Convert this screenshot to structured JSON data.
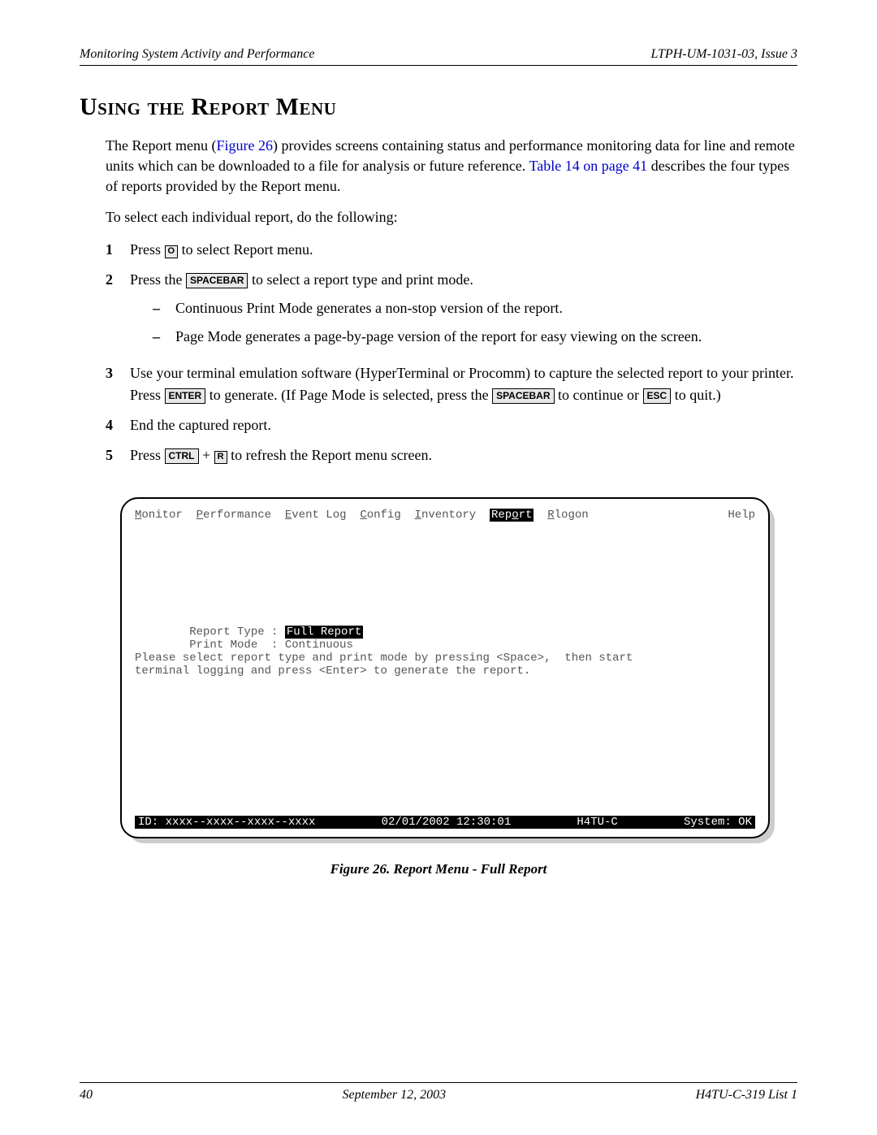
{
  "header": {
    "left": "Monitoring System Activity and Performance",
    "right": "LTPH-UM-1031-03, Issue 3"
  },
  "section_title": "Using the Report Menu",
  "intro": {
    "p1a": "The Report menu (",
    "fig_link": "Figure 26",
    "p1b": ") provides screens containing status and performance monitoring data for line and remote units which can be downloaded to a file for analysis or future reference. ",
    "table_link": "Table 14 on page 41",
    "p1c": " describes the four types of reports provided by the Report menu.",
    "p2": "To select each individual report, do the following:"
  },
  "steps": {
    "s1": {
      "num": "1",
      "a": "Press ",
      "key": "O",
      "b": " to select Report menu."
    },
    "s2": {
      "num": "2",
      "a": "Press the ",
      "key": "SPACEBAR",
      "b": " to select a report type and print mode.",
      "sub1": "Continuous Print Mode generates a non-stop version of the report.",
      "sub2": "Page Mode generates a page-by-page version of the report for easy viewing on the screen."
    },
    "s3": {
      "num": "3",
      "a": "Use your terminal emulation software (HyperTerminal or Procomm) to capture the selected report to your printer. Press ",
      "key1": "ENTER",
      "b": " to generate. (If Page Mode is selected, press the ",
      "key2": "SPACEBAR",
      "c": " to continue or ",
      "key3": "ESC",
      "d": " to quit.)"
    },
    "s4": {
      "num": "4",
      "text": "End the captured report."
    },
    "s5": {
      "num": "5",
      "a": "Press ",
      "key1": "CTRL",
      "plus": " + ",
      "key2": "R",
      "b": " to refresh the Report menu screen."
    }
  },
  "terminal": {
    "menu": {
      "monitor": "Monitor",
      "performance": "Performance",
      "eventlog": "Event Log",
      "config": "Config",
      "inventory": "Inventory",
      "report": "Report",
      "rlogon": "Rlogon",
      "help": "Help"
    },
    "report_type_label": "Report Type : ",
    "report_type_value": "Full Report",
    "print_mode_label": "Print Mode  : ",
    "print_mode_value": "Continuous",
    "hint1": "Please select report type and print mode by pressing <Space>,  then start",
    "hint2": "terminal logging and press <Enter> to generate the report.",
    "status_id": "ID: xxxx--xxxx--xxxx--xxxx",
    "status_dt": "02/01/2002 12:30:01",
    "status_unit": "H4TU-C",
    "status_sys": "System: OK"
  },
  "figure_caption": "Figure 26.    Report Menu - Full Report",
  "footer": {
    "left": "40",
    "center": "September 12, 2003",
    "right": "H4TU-C-319 List 1"
  }
}
